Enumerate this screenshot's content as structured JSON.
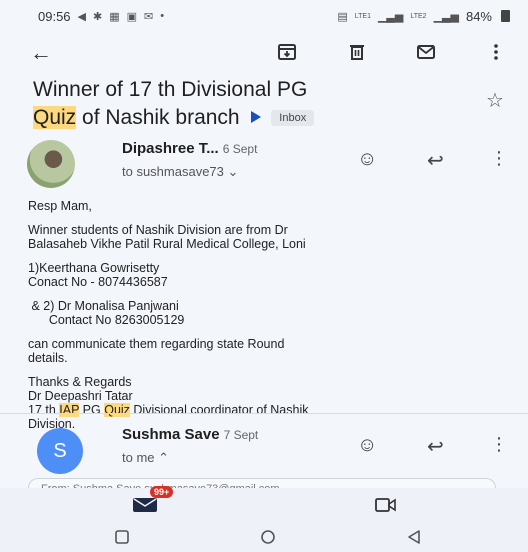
{
  "status_bar": {
    "time": "09:56",
    "battery": "84%",
    "left_icons": [
      "send-icon",
      "pin-icon",
      "gallery-icon",
      "message-icon",
      "mail-icon"
    ],
    "signal_labels": [
      "LTE1",
      "LTE2"
    ]
  },
  "email": {
    "subject_part1": "Winner of 17 th Divisional PG",
    "subject_highlight": "Quiz",
    "subject_part2": " of Nashik branch",
    "label": "Inbox"
  },
  "message1": {
    "sender": "Dipashree T...",
    "date": "6 Sept",
    "recipient": "to sushmasave73",
    "body": {
      "greeting": "Resp Mam,",
      "line1": "Winner students of Nashik Division are from Dr",
      "line2": "Balasaheb Vikhe Patil Rural Medical College, Loni",
      "w1_name": " 1)Keerthana Gowrisetty",
      "w1_contact": "Conact  No - 8074436587",
      "w2_name": " & 2) Dr Monalisa Panjwani",
      "w2_contact": "      Contact No 8263005129",
      "line3": "can  communicate them regarding state  Round",
      "line4": "details.",
      "closing1": "Thanks & Regards",
      "closing2": "Dr Deepashri Tatar",
      "sig_a": "17 th ",
      "sig_b": "IAP",
      "sig_c": " PG ",
      "sig_d": "Quiz",
      "sig_e": " Divisional coordinator of Nashik",
      "sig_f": "Division."
    }
  },
  "message2": {
    "avatar_letter": "S",
    "sender": "Sushma Save",
    "date": "7 Sept",
    "recipient": "to me"
  },
  "reply_preview": "From: Sushma Save      sushmasave73@gmail.com",
  "bottom_nav": {
    "mail_badge": "99+"
  },
  "colors": {
    "highlight": "#fcd87e",
    "accent": "#4e8ef7",
    "badge": "#d93025",
    "label_chevron": "#1a4fbf"
  }
}
